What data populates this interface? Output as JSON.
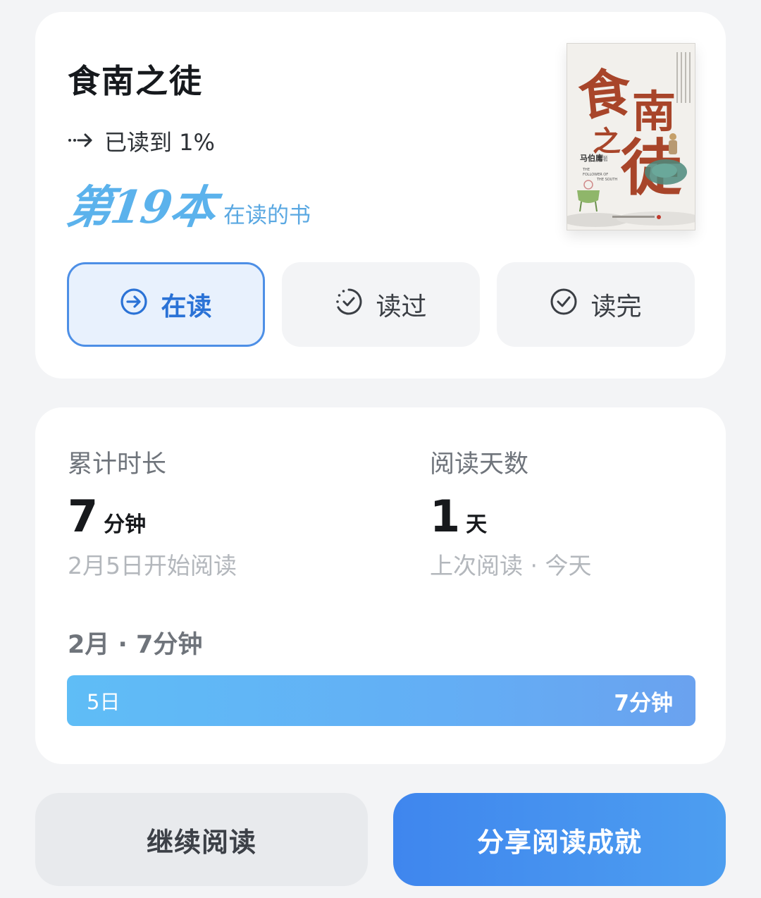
{
  "book": {
    "title": "食南之徒",
    "progress_text": "已读到 1%",
    "progress_percent": 1,
    "rank_text": "第19本",
    "rank_suffix": "在读的书",
    "cover": {
      "title_chars": [
        "食",
        "南",
        "之",
        "徒"
      ],
      "author": "马伯庸",
      "author_mark": "著",
      "english_line1": "THE",
      "english_line2": "FOLLOWER OF",
      "english_line3": "THE SOUTH",
      "colors": {
        "title": "#a8452a",
        "background": "#f2f0ec"
      }
    }
  },
  "status_buttons": [
    {
      "label": "在读",
      "icon": "arrow-circle-icon",
      "active": true
    },
    {
      "label": "读过",
      "icon": "dashed-check-circle-icon",
      "active": false
    },
    {
      "label": "读完",
      "icon": "check-circle-icon",
      "active": false
    }
  ],
  "stats": {
    "total_time": {
      "label": "累计时长",
      "value": "7",
      "unit": "分钟",
      "sub": "2月5日开始阅读"
    },
    "reading_days": {
      "label": "阅读天数",
      "value": "1",
      "unit": "天",
      "sub": "上次阅读 · 今天"
    },
    "month_summary": "2月 · 7分钟",
    "daily_bar": {
      "day": "5日",
      "time": "7分钟"
    }
  },
  "actions": {
    "continue": "继续阅读",
    "share": "分享阅读成就"
  },
  "colors": {
    "accent": "#4d8fe6",
    "active_bg": "#e8f1fd",
    "bar_start": "#5fbdf6",
    "bar_end": "#6aa2ef",
    "share_start": "#3f86ee",
    "share_end": "#4d9ef0"
  }
}
